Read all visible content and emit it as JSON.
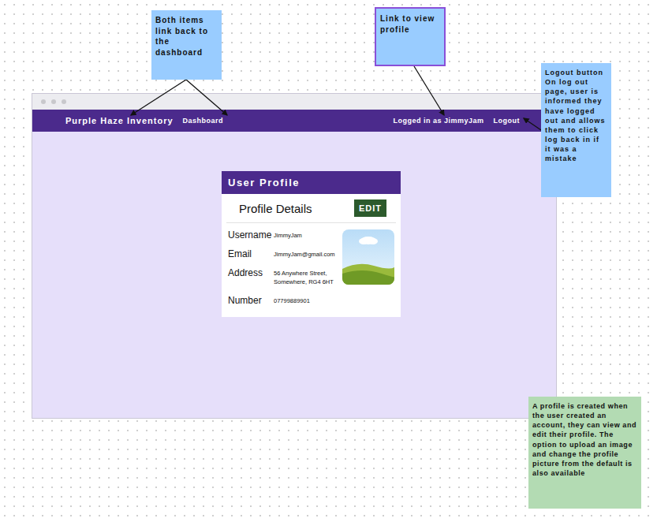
{
  "browser": {
    "nav": {
      "brand": "Purple Haze Inventory",
      "dashboard": "Dashboard",
      "user": "Logged in as JimmyJam",
      "logout": "Logout"
    }
  },
  "card": {
    "title": "User Profile",
    "section": "Profile Details",
    "edit_button": "EDIT",
    "fields": [
      {
        "label": "Username",
        "value": "JimmyJam"
      },
      {
        "label": "Email",
        "value": "JimmyJam@gmail.com"
      },
      {
        "label": "Address",
        "value": "56 Anywhere Street,\nSomewhere, RG4 6HT"
      },
      {
        "label": "Number",
        "value": "07799889901"
      }
    ]
  },
  "notes": [
    {
      "text": "Both items link back to the dashboard",
      "color": "#99ccff",
      "selected": false
    },
    {
      "text": "Link to view profile",
      "color": "#99ccff",
      "selected": true
    },
    {
      "text": "Logout button On log out page, user is informed they have logged out and allows them to click log back in if it was a mistake",
      "color": "#99ccff",
      "selected": false
    },
    {
      "text": "A profile is created when the user created an account, they can view and edit their profile. The option to upload an image and change the profile picture from the default is also available",
      "color": "#b3dbb3",
      "selected": false
    }
  ]
}
